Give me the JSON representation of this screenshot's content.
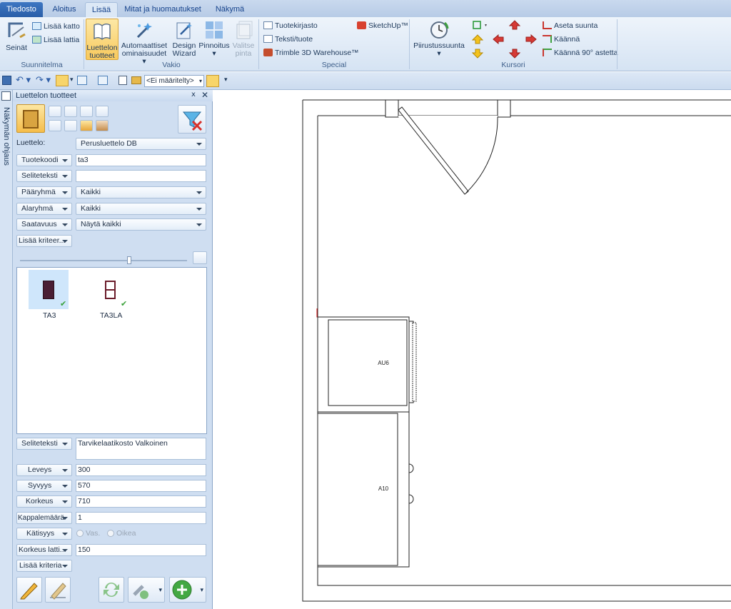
{
  "tabs": {
    "file": "Tiedosto",
    "t1": "Aloitus",
    "t2": "Lisää",
    "t3": "Mitat ja huomautukset",
    "t4": "Näkymä"
  },
  "ribbon": {
    "walls": "Seinät",
    "add_ceiling": "Lisää katto",
    "add_floor": "Lisää lattia",
    "group_plan": "Suunnitelma",
    "catalog_products_1": "Luettelon",
    "catalog_products_2": "tuotteet",
    "auto_props_1": "Automaattiset",
    "auto_props_2": "ominaisuudet",
    "design_wizard_1": "Design",
    "design_wizard_2": "Wizard",
    "coatings": "Pinnoitus",
    "select_surface_1": "Valitse",
    "select_surface_2": "pinta",
    "group_standard": "Vakio",
    "product_library": "Tuotekirjasto",
    "text_product": "Teksti/tuote",
    "trimble": "Trimble 3D Warehouse™",
    "sketchup": "SketchUp™",
    "group_special": "Special",
    "drawing_direction": "Piirustussuunta",
    "set_direction": "Aseta suunta",
    "rotate": "Käännä",
    "rotate90": "Käännä 90° astetta",
    "group_cursor": "Kursori"
  },
  "qat": {
    "view_select": "<Ei määritelty>"
  },
  "sidetab": {
    "label": "Näkymän ohjaus"
  },
  "panel": {
    "title": "Luettelon tuotteet",
    "catalog_label": "Luettelo:",
    "catalog_value": "Perusluettelo DB",
    "product_code_label": "Tuotekoodi",
    "product_code_value": "ta3",
    "desc_label": "Seliteteksti",
    "desc_value": "",
    "main_group_label": "Pääryhmä",
    "main_group_value": "Kaikki",
    "sub_group_label": "Alaryhmä",
    "sub_group_value": "Kaikki",
    "availability_label": "Saatavuus",
    "availability_value": "Näytä kaikki",
    "add_criteria_top": "Lisää kriteer...",
    "items": [
      {
        "name": "TA3",
        "color": "#4a1e33"
      },
      {
        "name": "TA3LA",
        "color": "#6b1d2b"
      }
    ],
    "sel_desc_label": "Seliteteksti",
    "sel_desc_value": "Tarvikelaatikosto  Valkoinen",
    "width_label": "Leveys",
    "width_value": "300",
    "depth_label": "Syvyys",
    "depth_value": "570",
    "height_label": "Korkeus",
    "height_value": "710",
    "qty_label": "Kappalemäärä",
    "qty_value": "1",
    "hand_label": "Kätisyys",
    "hand_left": "Vas.",
    "hand_right": "Oikea",
    "floor_height_label": "Korkeus latti...",
    "floor_height_value": "150",
    "add_criteria": "Lisää kriteria"
  },
  "drawing": {
    "cab_top": "AU6",
    "cab_bottom": "A10"
  }
}
